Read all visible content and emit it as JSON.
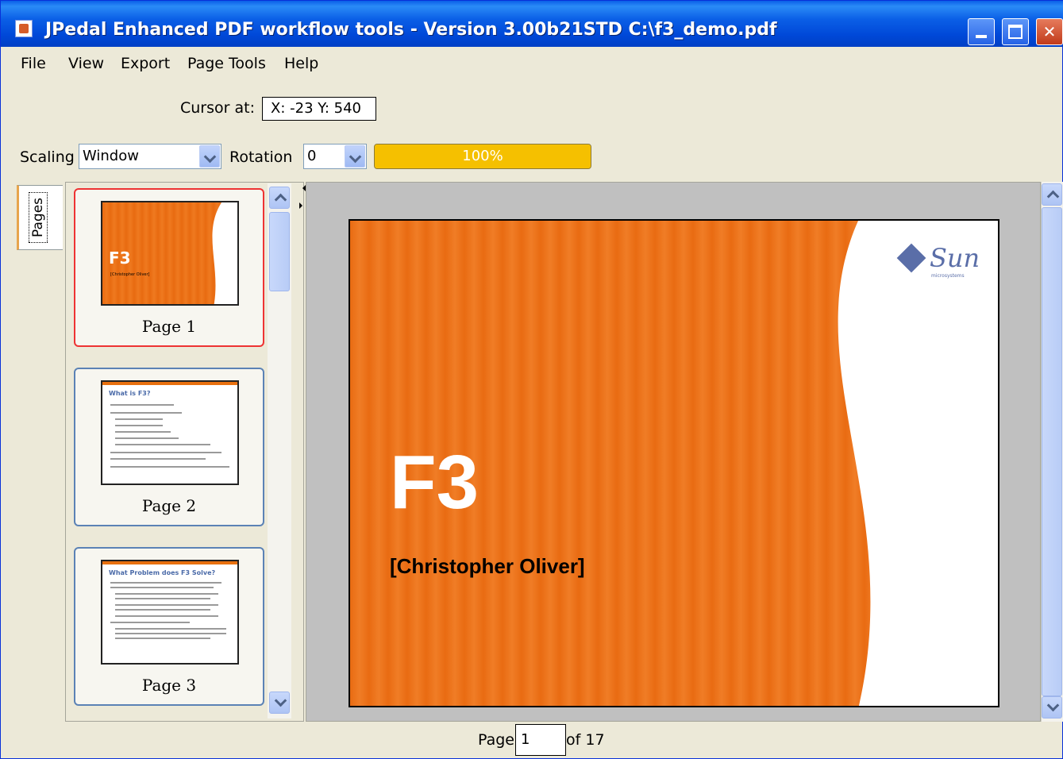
{
  "window": {
    "title": "JPedal Enhanced PDF workflow tools - Version 3.00b21STD C:\\f3_demo.pdf",
    "icon": "java-cup-icon"
  },
  "menu": {
    "items": [
      "File",
      "View",
      "Export",
      "Page Tools",
      "Help"
    ]
  },
  "toolbar": {
    "cursor_label": "Cursor at:",
    "cursor_value": "X: -23 Y: 540",
    "scaling_label": "Scaling",
    "scaling_value": "Window",
    "rotation_label": "Rotation",
    "rotation_value": "0",
    "progress_text": "100%",
    "progress_fraction": 1.0,
    "progress_color": "#f5c000"
  },
  "sidebar": {
    "tab_label": "Pages",
    "thumbnails": [
      {
        "caption": "Page 1",
        "selected": true
      },
      {
        "caption": "Page 2",
        "selected": false
      },
      {
        "caption": "Page 3",
        "selected": false
      }
    ]
  },
  "slide": {
    "title": "F3",
    "author": "[Christopher Oliver]",
    "logo_text": "Sun",
    "logo_tagline": "microsystems",
    "accent_color": "#e96b12"
  },
  "thumb2": {
    "title": "What is F3?"
  },
  "thumb3": {
    "title": "What Problem does F3 Solve?"
  },
  "statusbar": {
    "page_label": "Page",
    "page_value": "1",
    "of_label": "of 17"
  }
}
